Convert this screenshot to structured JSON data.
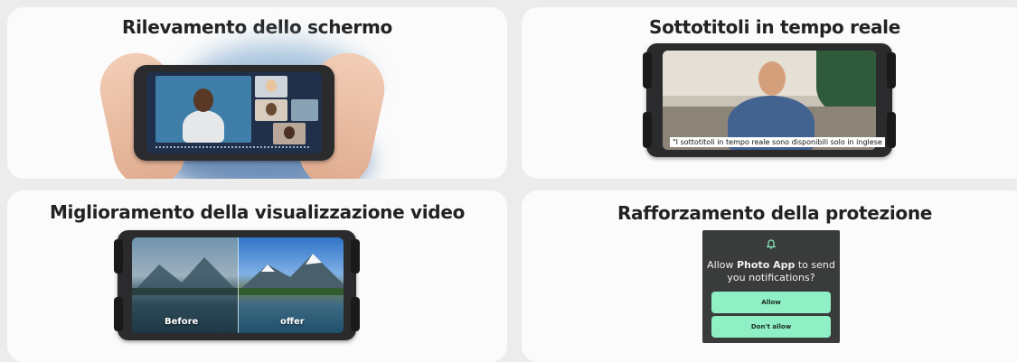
{
  "cards": [
    {
      "title": "Rilevamento dello schermo"
    },
    {
      "title": "Sottotitoli in tempo reale",
      "subtitle_text": "\"I sottotitoli in tempo reale sono disponibili solo in inglese"
    },
    {
      "title": "Miglioramento della visualizzazione video",
      "before_label": "Before",
      "after_label": "offer"
    },
    {
      "title": "Rafforzamento della protezione",
      "notification": {
        "prefix": "Allow ",
        "app_name": "Photo App",
        "suffix": " to send you notifications?",
        "allow_label": "Allow",
        "deny_label": "Don't allow"
      }
    }
  ],
  "colors": {
    "phone_body": "#2b2b2d",
    "accent_green": "#8ef0c4",
    "card_bg": "#fbfbfb",
    "page_bg": "#ececec"
  },
  "icons": [
    "bell-icon"
  ]
}
